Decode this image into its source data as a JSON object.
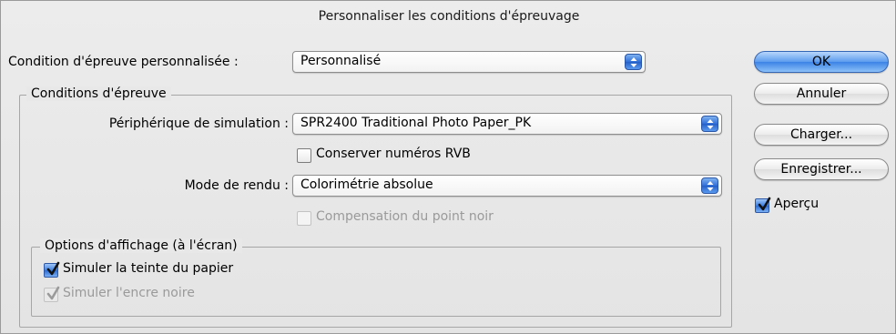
{
  "dialog": {
    "title": "Personnaliser les conditions d'épreuvage"
  },
  "condition": {
    "label": "Condition d'épreuve personnalisée :",
    "value": "Personnalisé"
  },
  "proof_conditions": {
    "legend": "Conditions d'épreuve",
    "device_label": "Périphérique de simulation :",
    "device_value": "SPR2400 Traditional Photo Paper_PK",
    "preserve_rgb": {
      "label": "Conserver numéros RVB",
      "checked": false,
      "enabled": true
    },
    "intent_label": "Mode de rendu :",
    "intent_value": "Colorimétrie absolue",
    "black_point": {
      "label": "Compensation du point noir",
      "checked": false,
      "enabled": false
    }
  },
  "display_options": {
    "legend": "Options d'affichage (à l'écran)",
    "paper_color": {
      "label": "Simuler la teinte du papier",
      "checked": true,
      "enabled": true
    },
    "black_ink": {
      "label": "Simuler l'encre noire",
      "checked": true,
      "enabled": false
    }
  },
  "buttons": {
    "ok": "OK",
    "cancel": "Annuler",
    "load": "Charger...",
    "save": "Enregistrer..."
  },
  "preview": {
    "label": "Aperçu",
    "checked": true
  }
}
